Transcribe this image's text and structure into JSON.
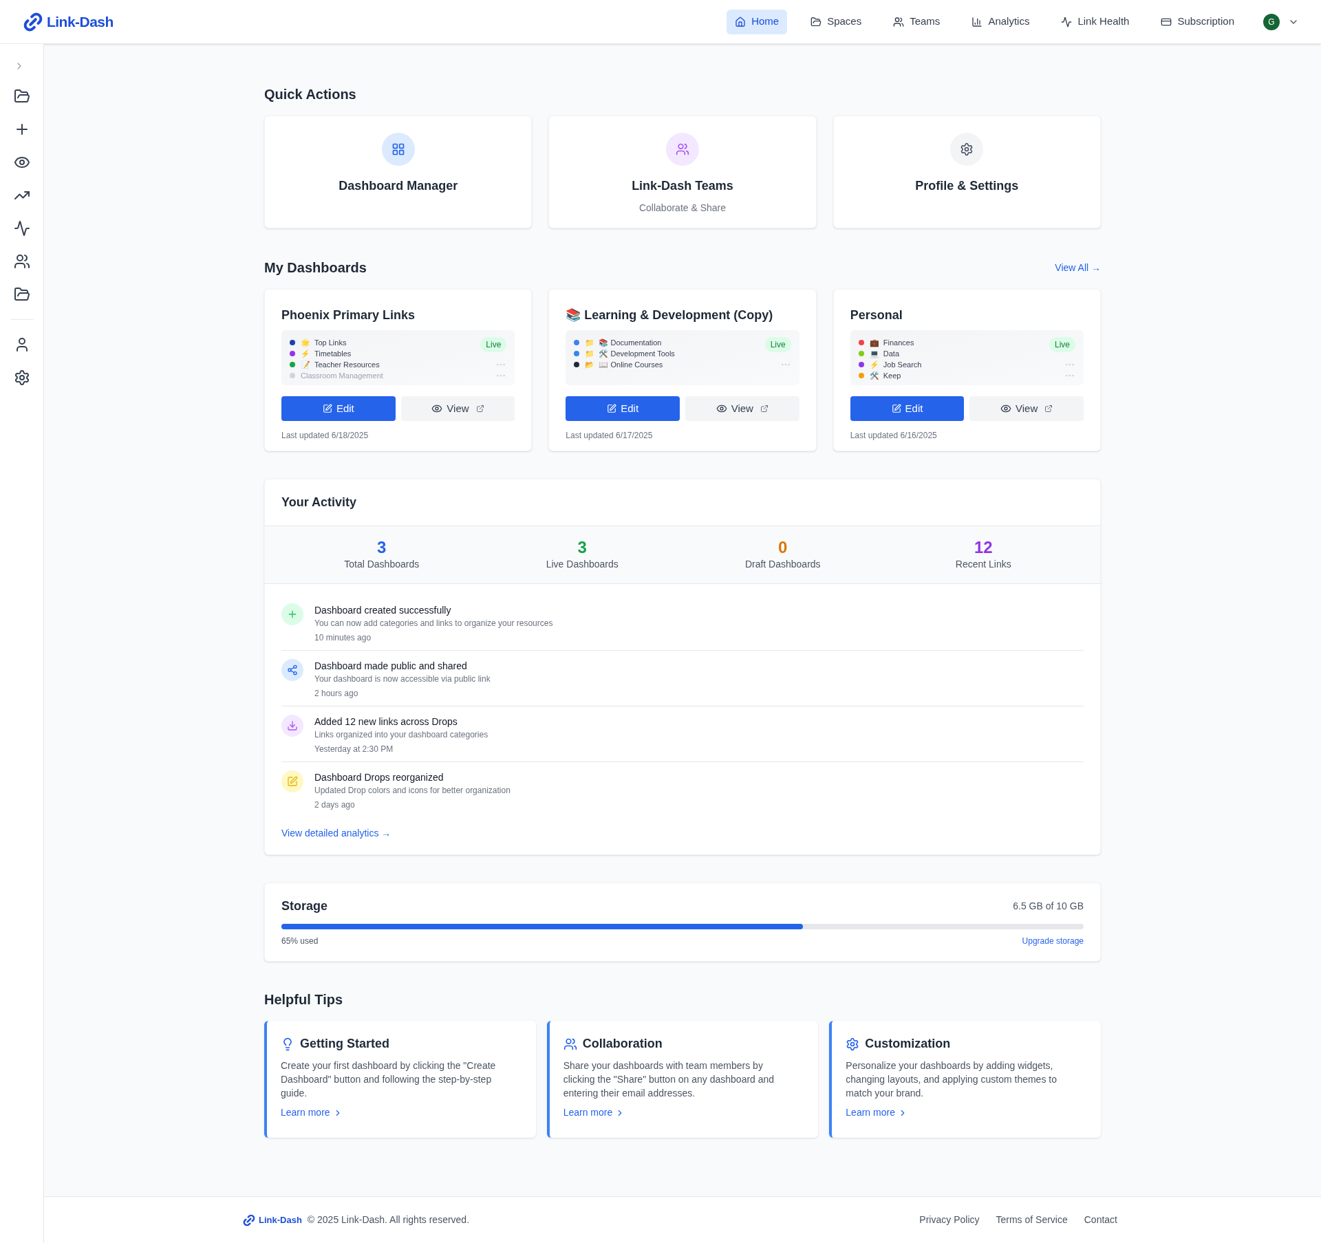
{
  "header": {
    "logo": "Link-Dash",
    "nav": [
      {
        "label": "Home",
        "selected": true
      },
      {
        "label": "Spaces",
        "selected": false
      },
      {
        "label": "Teams",
        "selected": false
      },
      {
        "label": "Analytics",
        "selected": false
      },
      {
        "label": "Link Health",
        "selected": false
      },
      {
        "label": "Subscription",
        "selected": false
      }
    ],
    "avatar": "G"
  },
  "quick_actions": {
    "title": "Quick Actions",
    "cards": [
      {
        "title": "Dashboard Manager"
      },
      {
        "title": "Link-Dash Teams",
        "subtitle": "Collaborate & Share"
      },
      {
        "title": "Profile & Settings"
      }
    ]
  },
  "my_dashboards": {
    "title": "My Dashboards",
    "view_all": "View All →",
    "cards": [
      {
        "title": "Phoenix Primary Links",
        "status": "Live",
        "edit": "Edit",
        "view": "View",
        "updated": "Last updated 6/18/2025",
        "links": [
          {
            "color": "#1e40af",
            "label": "🌟  Top Links",
            "faded": false
          },
          {
            "color": "#9333ea",
            "label": "⚡  Timetables",
            "faded": false
          },
          {
            "color": "#16a34a",
            "label": "📝  Teacher Resources",
            "faded": false
          },
          {
            "color": "#d1d5db",
            "label": "Classroom Management",
            "faded": true
          }
        ]
      },
      {
        "title": "📚 Learning & Development (Copy)",
        "status": "Live",
        "edit": "Edit",
        "view": "View",
        "updated": "Last updated 6/17/2025",
        "links": [
          {
            "color": "#3b82f6",
            "label": "📁  📚 Documentation",
            "faded": false
          },
          {
            "color": "#3b82f6",
            "label": "📁  🛠️ Development Tools",
            "faded": false
          },
          {
            "color": "#1f2937",
            "label": "📂  📖 Online Courses",
            "faded": false
          }
        ]
      },
      {
        "title": "Personal",
        "status": "Live",
        "edit": "Edit",
        "view": "View",
        "updated": "Last updated 6/16/2025",
        "links": [
          {
            "color": "#ef4444",
            "label": "💼  Finances",
            "faded": false
          },
          {
            "color": "#84cc16",
            "label": "💻  Data",
            "faded": false
          },
          {
            "color": "#9333ea",
            "label": "⚡  Job Search",
            "faded": false
          },
          {
            "color": "#f59e0b",
            "label": "🛠️  Keep",
            "faded": false
          }
        ]
      }
    ]
  },
  "activity": {
    "title": "Your Activity",
    "stats": [
      {
        "value": "3",
        "label": "Total Dashboards",
        "color": "#2563eb"
      },
      {
        "value": "3",
        "label": "Live Dashboards",
        "color": "#16a34a"
      },
      {
        "value": "0",
        "label": "Draft Dashboards",
        "color": "#d97706"
      },
      {
        "value": "12",
        "label": "Recent Links",
        "color": "#9333ea"
      }
    ],
    "events": [
      {
        "kind": "created",
        "title": "Dashboard created successfully",
        "detail": "You can now add categories and links to organize your resources",
        "time": "10 minutes ago"
      },
      {
        "kind": "shared",
        "title": "Dashboard made public and shared",
        "detail": "Your dashboard is now accessible via public link",
        "time": "2 hours ago"
      },
      {
        "kind": "added",
        "title": "Added 12 new links across Drops",
        "detail": "Links organized into your dashboard categories",
        "time": "Yesterday at 2:30 PM"
      },
      {
        "kind": "edited",
        "title": "Dashboard Drops reorganized",
        "detail": "Updated Drop colors and icons for better organization",
        "time": "2 days ago"
      }
    ],
    "link": "View detailed analytics →"
  },
  "storage": {
    "title": "Storage",
    "reading": "6.5 GB of 10 GB",
    "level": 0.65,
    "used": "65% used",
    "upgrade": "Upgrade storage"
  },
  "tips": {
    "title": "Helpful Tips",
    "cards": [
      {
        "title": "Getting Started",
        "text": "Create your first dashboard by clicking the \"Create Dashboard\" button and following the step-by-step guide.",
        "link": "Learn more"
      },
      {
        "title": "Collaboration",
        "text": "Share your dashboards with team members by clicking the \"Share\" button on any dashboard and entering their email addresses.",
        "link": "Learn more"
      },
      {
        "title": "Customization",
        "text": "Personalize your dashboards by adding widgets, changing layouts, and applying custom themes to match your brand.",
        "link": "Learn more"
      }
    ]
  },
  "footer": {
    "logo": "Link-Dash",
    "copyright": "© 2025 Link-Dash. All rights reserved.",
    "links": [
      "Privacy Policy",
      "Terms of Service",
      "Contact"
    ]
  }
}
